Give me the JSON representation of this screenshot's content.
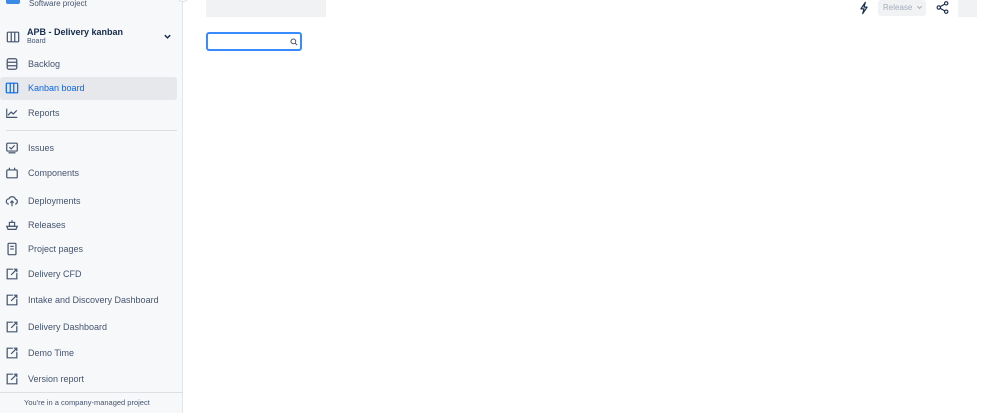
{
  "project": {
    "type_label": "Software project"
  },
  "board": {
    "title": "APB - Delivery kanban",
    "subtitle": "Board"
  },
  "nav": {
    "planning": [
      {
        "label": "Backlog",
        "icon": "backlog-icon"
      },
      {
        "label": "Kanban board",
        "icon": "board-columns-icon",
        "active": true
      },
      {
        "label": "Reports",
        "icon": "reports-chart-icon"
      }
    ],
    "development": [
      {
        "label": "Issues",
        "icon": "issues-icon"
      },
      {
        "label": "Components",
        "icon": "components-icon"
      },
      {
        "label": "Deployments",
        "icon": "cloud-upload-icon"
      },
      {
        "label": "Releases",
        "icon": "ship-icon"
      },
      {
        "label": "Project pages",
        "icon": "page-icon"
      },
      {
        "label": "Delivery CFD",
        "icon": "external-link-icon"
      },
      {
        "label": "Intake and Discovery Dashboard",
        "icon": "external-link-icon"
      },
      {
        "label": "Delivery Dashboard",
        "icon": "external-link-icon"
      },
      {
        "label": "Demo Time",
        "icon": "external-link-icon"
      },
      {
        "label": "Version report",
        "icon": "external-link-icon"
      }
    ]
  },
  "footer": {
    "text": "You're in a company-managed project"
  },
  "toolbar": {
    "release_label": "Release"
  },
  "search": {
    "placeholder": ""
  },
  "colors": {
    "accent": "#0c66e4",
    "active_bg": "#e6e8ec",
    "focus_border": "#388bff",
    "sidebar_bg": "#f7f8f9"
  }
}
